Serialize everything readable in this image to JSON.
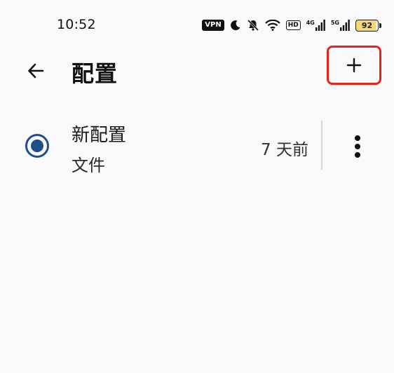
{
  "status_bar": {
    "time": "10:52",
    "vpn": "VPN",
    "hd": "HD",
    "net1": "4G",
    "net2": "5G",
    "battery": "92",
    "icons": [
      "vpn-icon",
      "moon-icon",
      "bell-off-icon",
      "wifi-icon",
      "hd-icon",
      "signal-4g-icon",
      "signal-5g-icon",
      "battery-icon"
    ]
  },
  "app_bar": {
    "title": "配置",
    "back_icon": "arrow-left-icon",
    "add_icon": "plus-icon"
  },
  "profiles": [
    {
      "name": "新配置",
      "type": "文件",
      "updated": "7 天前",
      "selected": true
    }
  ],
  "colors": {
    "background": "#f9f9fb",
    "accent": "#1f4e88",
    "highlight_box": "#e8231a",
    "battery_fill": "#f3d57a"
  }
}
